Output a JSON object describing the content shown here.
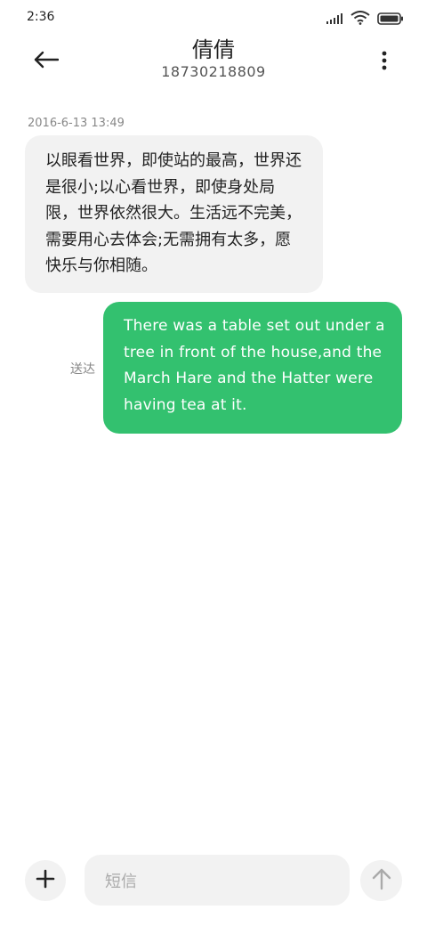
{
  "status_bar": {
    "time": "2:36",
    "icons": [
      "signal-icon",
      "wifi-icon",
      "battery-icon"
    ]
  },
  "header": {
    "back_icon": "back-arrow-icon",
    "contact_name": "倩倩",
    "contact_number": "18730218809",
    "more_icon": "more-vertical-icon"
  },
  "conversation": {
    "timestamp": "2016-6-13  13:49",
    "incoming_message": "以眼看世界，即使站的最高，世界还是很小;以心看世界，即使身处局限，世界依然很大。生活远不完美，需要用心去体会;无需拥有太多，愿快乐与你相随。",
    "outgoing_message": "There was a table set out under a tree in front of the house,and the March Hare and the Hatter were having tea at it.",
    "delivery_status": "送达"
  },
  "input_bar": {
    "add_icon": "plus-icon",
    "placeholder": "短信",
    "send_icon": "arrow-up-icon"
  },
  "colors": {
    "outgoing_bubble": "#33c16f",
    "incoming_bubble": "#f2f2f2",
    "background": "#ffffff"
  }
}
